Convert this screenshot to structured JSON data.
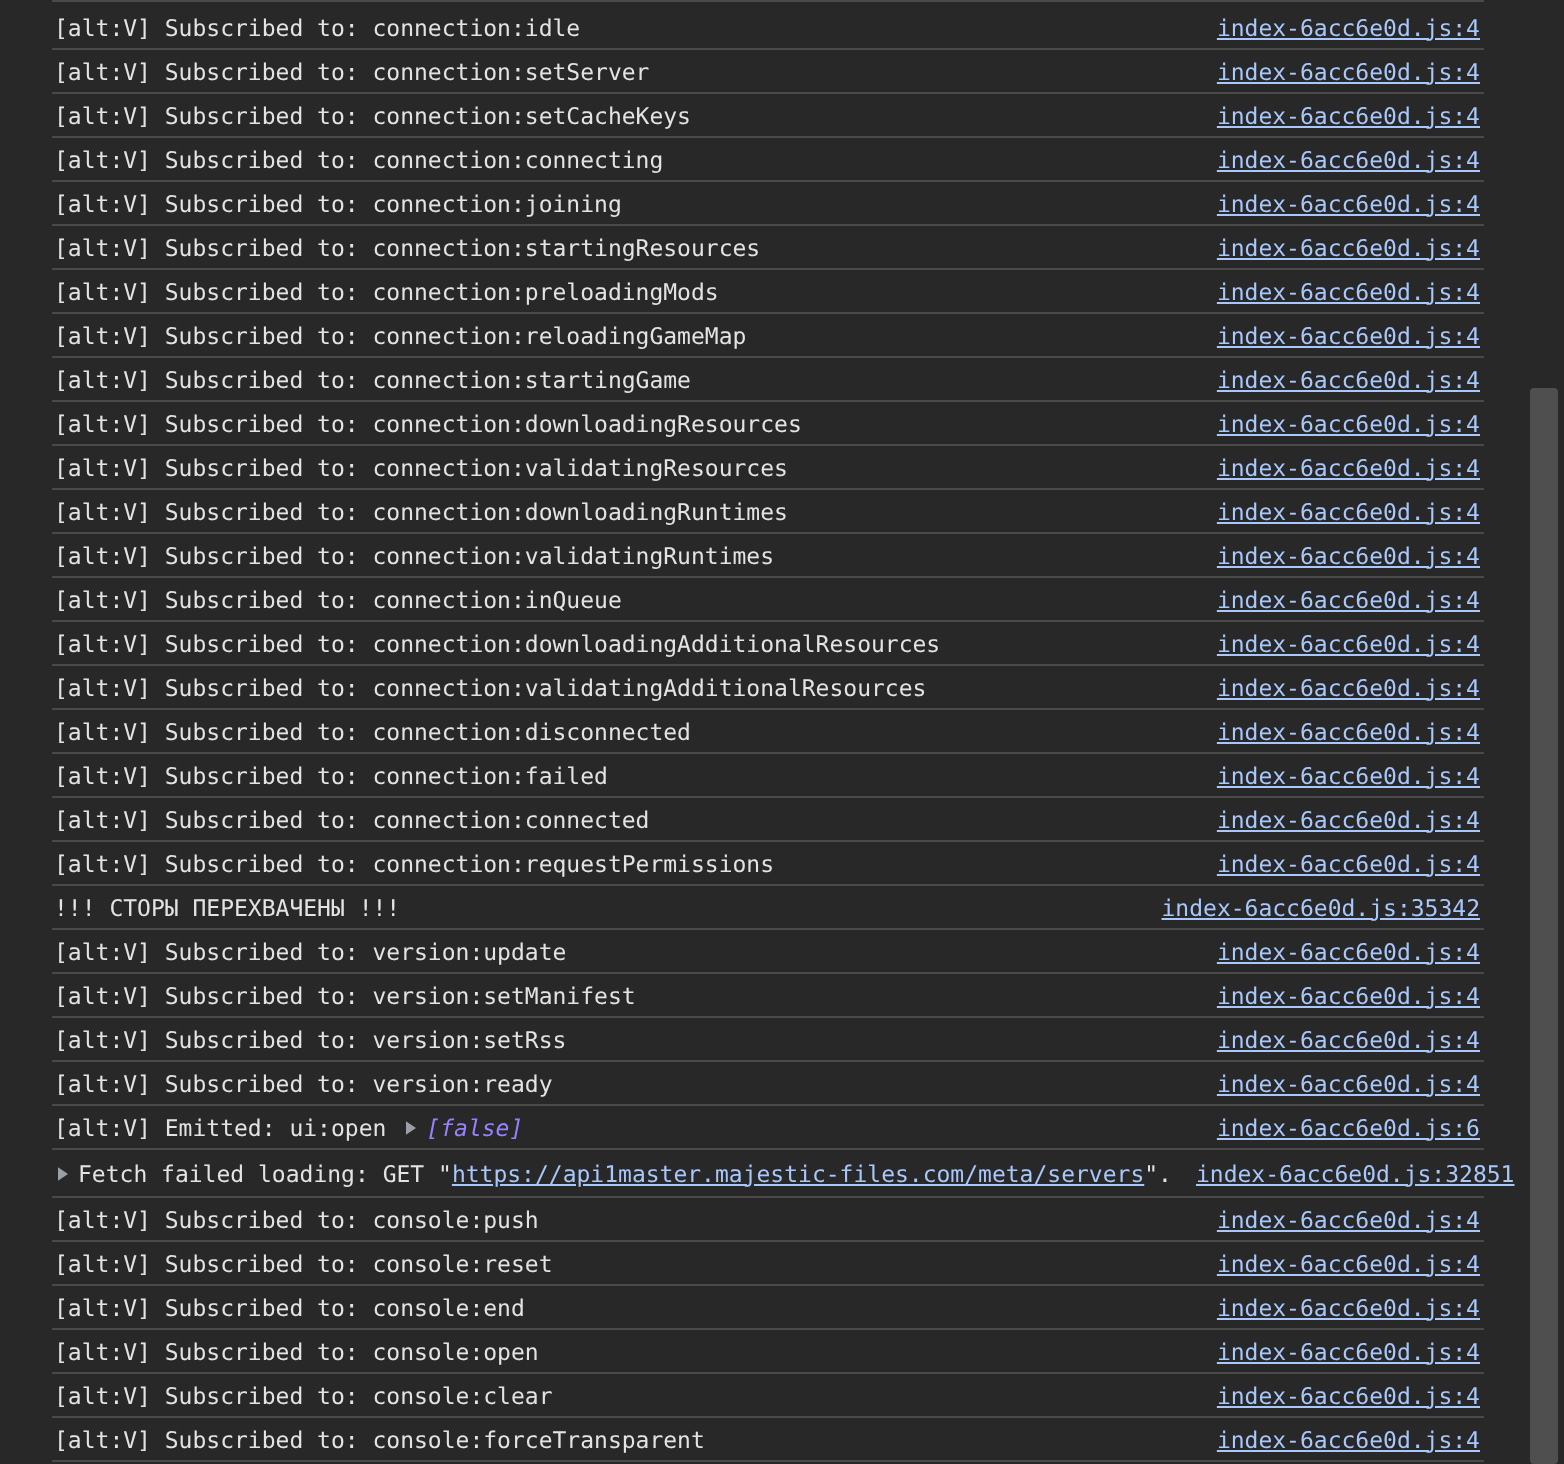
{
  "console": {
    "rows": [
      {
        "kind": "log",
        "message": "[alt:V] Subscribed to: connection:idle",
        "source": "index-6acc6e0d.js:4"
      },
      {
        "kind": "log",
        "message": "[alt:V] Subscribed to: connection:setServer",
        "source": "index-6acc6e0d.js:4"
      },
      {
        "kind": "log",
        "message": "[alt:V] Subscribed to: connection:setCacheKeys",
        "source": "index-6acc6e0d.js:4"
      },
      {
        "kind": "log",
        "message": "[alt:V] Subscribed to: connection:connecting",
        "source": "index-6acc6e0d.js:4"
      },
      {
        "kind": "log",
        "message": "[alt:V] Subscribed to: connection:joining",
        "source": "index-6acc6e0d.js:4"
      },
      {
        "kind": "log",
        "message": "[alt:V] Subscribed to: connection:startingResources",
        "source": "index-6acc6e0d.js:4"
      },
      {
        "kind": "log",
        "message": "[alt:V] Subscribed to: connection:preloadingMods",
        "source": "index-6acc6e0d.js:4"
      },
      {
        "kind": "log",
        "message": "[alt:V] Subscribed to: connection:reloadingGameMap",
        "source": "index-6acc6e0d.js:4"
      },
      {
        "kind": "log",
        "message": "[alt:V] Subscribed to: connection:startingGame",
        "source": "index-6acc6e0d.js:4"
      },
      {
        "kind": "log",
        "message": "[alt:V] Subscribed to: connection:downloadingResources",
        "source": "index-6acc6e0d.js:4"
      },
      {
        "kind": "log",
        "message": "[alt:V] Subscribed to: connection:validatingResources",
        "source": "index-6acc6e0d.js:4"
      },
      {
        "kind": "log",
        "message": "[alt:V] Subscribed to: connection:downloadingRuntimes",
        "source": "index-6acc6e0d.js:4"
      },
      {
        "kind": "log",
        "message": "[alt:V] Subscribed to: connection:validatingRuntimes",
        "source": "index-6acc6e0d.js:4"
      },
      {
        "kind": "log",
        "message": "[alt:V] Subscribed to: connection:inQueue",
        "source": "index-6acc6e0d.js:4"
      },
      {
        "kind": "log",
        "message": "[alt:V] Subscribed to: connection:downloadingAdditionalResources",
        "source": "index-6acc6e0d.js:4"
      },
      {
        "kind": "log",
        "message": "[alt:V] Subscribed to: connection:validatingAdditionalResources",
        "source": "index-6acc6e0d.js:4"
      },
      {
        "kind": "log",
        "message": "[alt:V] Subscribed to: connection:disconnected",
        "source": "index-6acc6e0d.js:4"
      },
      {
        "kind": "log",
        "message": "[alt:V] Subscribed to: connection:failed",
        "source": "index-6acc6e0d.js:4"
      },
      {
        "kind": "log",
        "message": "[alt:V] Subscribed to: connection:connected",
        "source": "index-6acc6e0d.js:4"
      },
      {
        "kind": "log",
        "message": "[alt:V] Subscribed to: connection:requestPermissions",
        "source": "index-6acc6e0d.js:4"
      },
      {
        "kind": "log",
        "message": "!!! СТОРЫ ПЕРЕХВАЧЕНЫ !!!",
        "source": "index-6acc6e0d.js:35342"
      },
      {
        "kind": "log",
        "message": "[alt:V] Subscribed to: version:update",
        "source": "index-6acc6e0d.js:4"
      },
      {
        "kind": "log",
        "message": "[alt:V] Subscribed to: version:setManifest",
        "source": "index-6acc6e0d.js:4"
      },
      {
        "kind": "log",
        "message": "[alt:V] Subscribed to: version:setRss",
        "source": "index-6acc6e0d.js:4"
      },
      {
        "kind": "log",
        "message": "[alt:V] Subscribed to: version:ready",
        "source": "index-6acc6e0d.js:4"
      },
      {
        "kind": "object",
        "message": "[alt:V] Emitted: ui:open",
        "value": "[false]",
        "expanded": false,
        "source": "index-6acc6e0d.js:6"
      },
      {
        "kind": "fetch",
        "message": "Fetch failed loading: GET \"",
        "url": "https://api1master.majestic-files.com/meta/servers",
        "suffix": "\".",
        "expanded": false,
        "source": "index-6acc6e0d.js:32851"
      },
      {
        "kind": "log",
        "message": "[alt:V] Subscribed to: console:push",
        "source": "index-6acc6e0d.js:4"
      },
      {
        "kind": "log",
        "message": "[alt:V] Subscribed to: console:reset",
        "source": "index-6acc6e0d.js:4"
      },
      {
        "kind": "log",
        "message": "[alt:V] Subscribed to: console:end",
        "source": "index-6acc6e0d.js:4"
      },
      {
        "kind": "log",
        "message": "[alt:V] Subscribed to: console:open",
        "source": "index-6acc6e0d.js:4"
      },
      {
        "kind": "log",
        "message": "[alt:V] Subscribed to: console:clear",
        "source": "index-6acc6e0d.js:4"
      },
      {
        "kind": "log",
        "message": "[alt:V] Subscribed to: console:forceTransparent",
        "source": "index-6acc6e0d.js:4"
      }
    ]
  }
}
